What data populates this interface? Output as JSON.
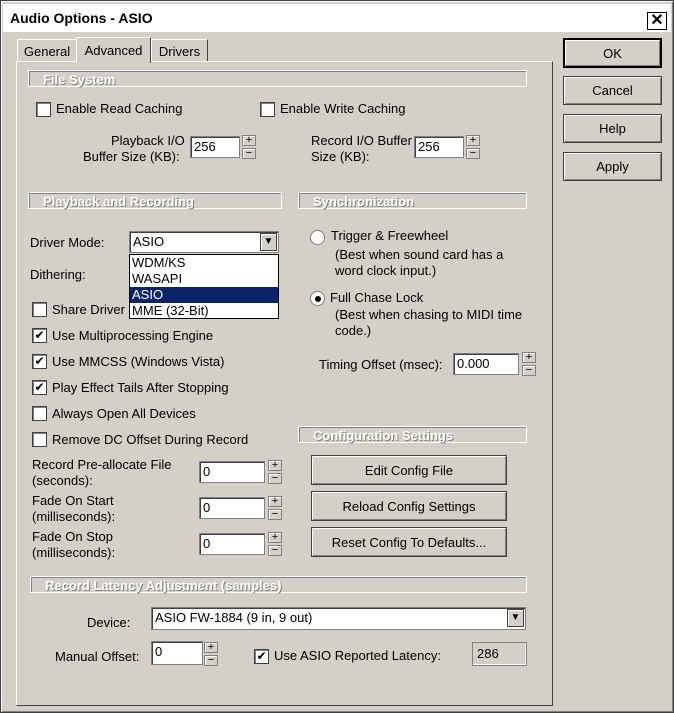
{
  "window": {
    "title": "Audio Options - ASIO",
    "close_glyph": "✕"
  },
  "tabs": [
    {
      "label": "General",
      "active": false
    },
    {
      "label": "Advanced",
      "active": true
    },
    {
      "label": "Drivers",
      "active": false
    }
  ],
  "buttons": {
    "ok": "OK",
    "cancel": "Cancel",
    "help": "Help",
    "apply": "Apply"
  },
  "file_system": {
    "header": "File System",
    "read_caching": {
      "label": "Enable Read Caching",
      "checked": false
    },
    "write_caching": {
      "label": "Enable Write Caching",
      "checked": false
    },
    "playback_buffer": {
      "label_line1": "Playback I/O",
      "label_line2": "Buffer Size (KB):",
      "value": "256"
    },
    "record_buffer": {
      "label_line1": "Record I/O Buffer",
      "label_line2": "Size (KB):",
      "value": "256"
    }
  },
  "playback_recording": {
    "header": "Playback and Recording",
    "driver_mode_label": "Driver Mode:",
    "driver_mode_value": "ASIO",
    "driver_options": [
      "WDM/KS",
      "WASAPI",
      "ASIO",
      "MME (32-Bit)"
    ],
    "dithering_label": "Dithering:",
    "share_drivers": {
      "label": "Share Driver",
      "checked": false
    },
    "multiprocessing": {
      "label": "Use Multiprocessing Engine",
      "checked": true
    },
    "mmcss": {
      "label": "Use MMCSS (Windows Vista)",
      "checked": true
    },
    "effect_tails": {
      "label": "Play Effect Tails After Stopping",
      "checked": true
    },
    "open_all": {
      "label": "Always Open All Devices",
      "checked": false
    },
    "dc_offset": {
      "label": "Remove DC Offset During Record",
      "checked": false
    },
    "preallocate": {
      "label_line1": "Record Pre-allocate File",
      "label_line2": "(seconds):",
      "value": "0"
    },
    "fade_start": {
      "label_line1": "Fade On Start",
      "label_line2": "(milliseconds):",
      "value": "0"
    },
    "fade_stop": {
      "label_line1": "Fade On Stop",
      "label_line2": "(milliseconds):",
      "value": "0"
    }
  },
  "synchronization": {
    "header": "Synchronization",
    "trigger": {
      "label": "Trigger & Freewheel",
      "desc_line1": "(Best when sound card has a",
      "desc_line2": "word clock input.)",
      "selected": false
    },
    "full_chase": {
      "label": "Full Chase Lock",
      "desc_line1": "(Best when chasing to MIDI time",
      "desc_line2": "code.)",
      "selected": true
    },
    "timing_offset_label": "Timing Offset (msec):",
    "timing_offset_value": "0.000"
  },
  "configuration": {
    "header": "Configuration Settings",
    "edit": "Edit Config File",
    "reload": "Reload Config Settings",
    "reset": "Reset Config To Defaults..."
  },
  "latency": {
    "header": "Record Latency Adjustment (samples)",
    "device_label": "Device:",
    "device_value": "ASIO FW-1884 (9 in, 9 out)",
    "manual_offset_label": "Manual Offset:",
    "manual_offset_value": "0",
    "use_asio": {
      "label": "Use ASIO Reported Latency:",
      "checked": true
    },
    "reported_value": "286"
  },
  "glyphs": {
    "check": "✔",
    "arrow_down": "▼",
    "plus": "+",
    "minus": "−"
  }
}
